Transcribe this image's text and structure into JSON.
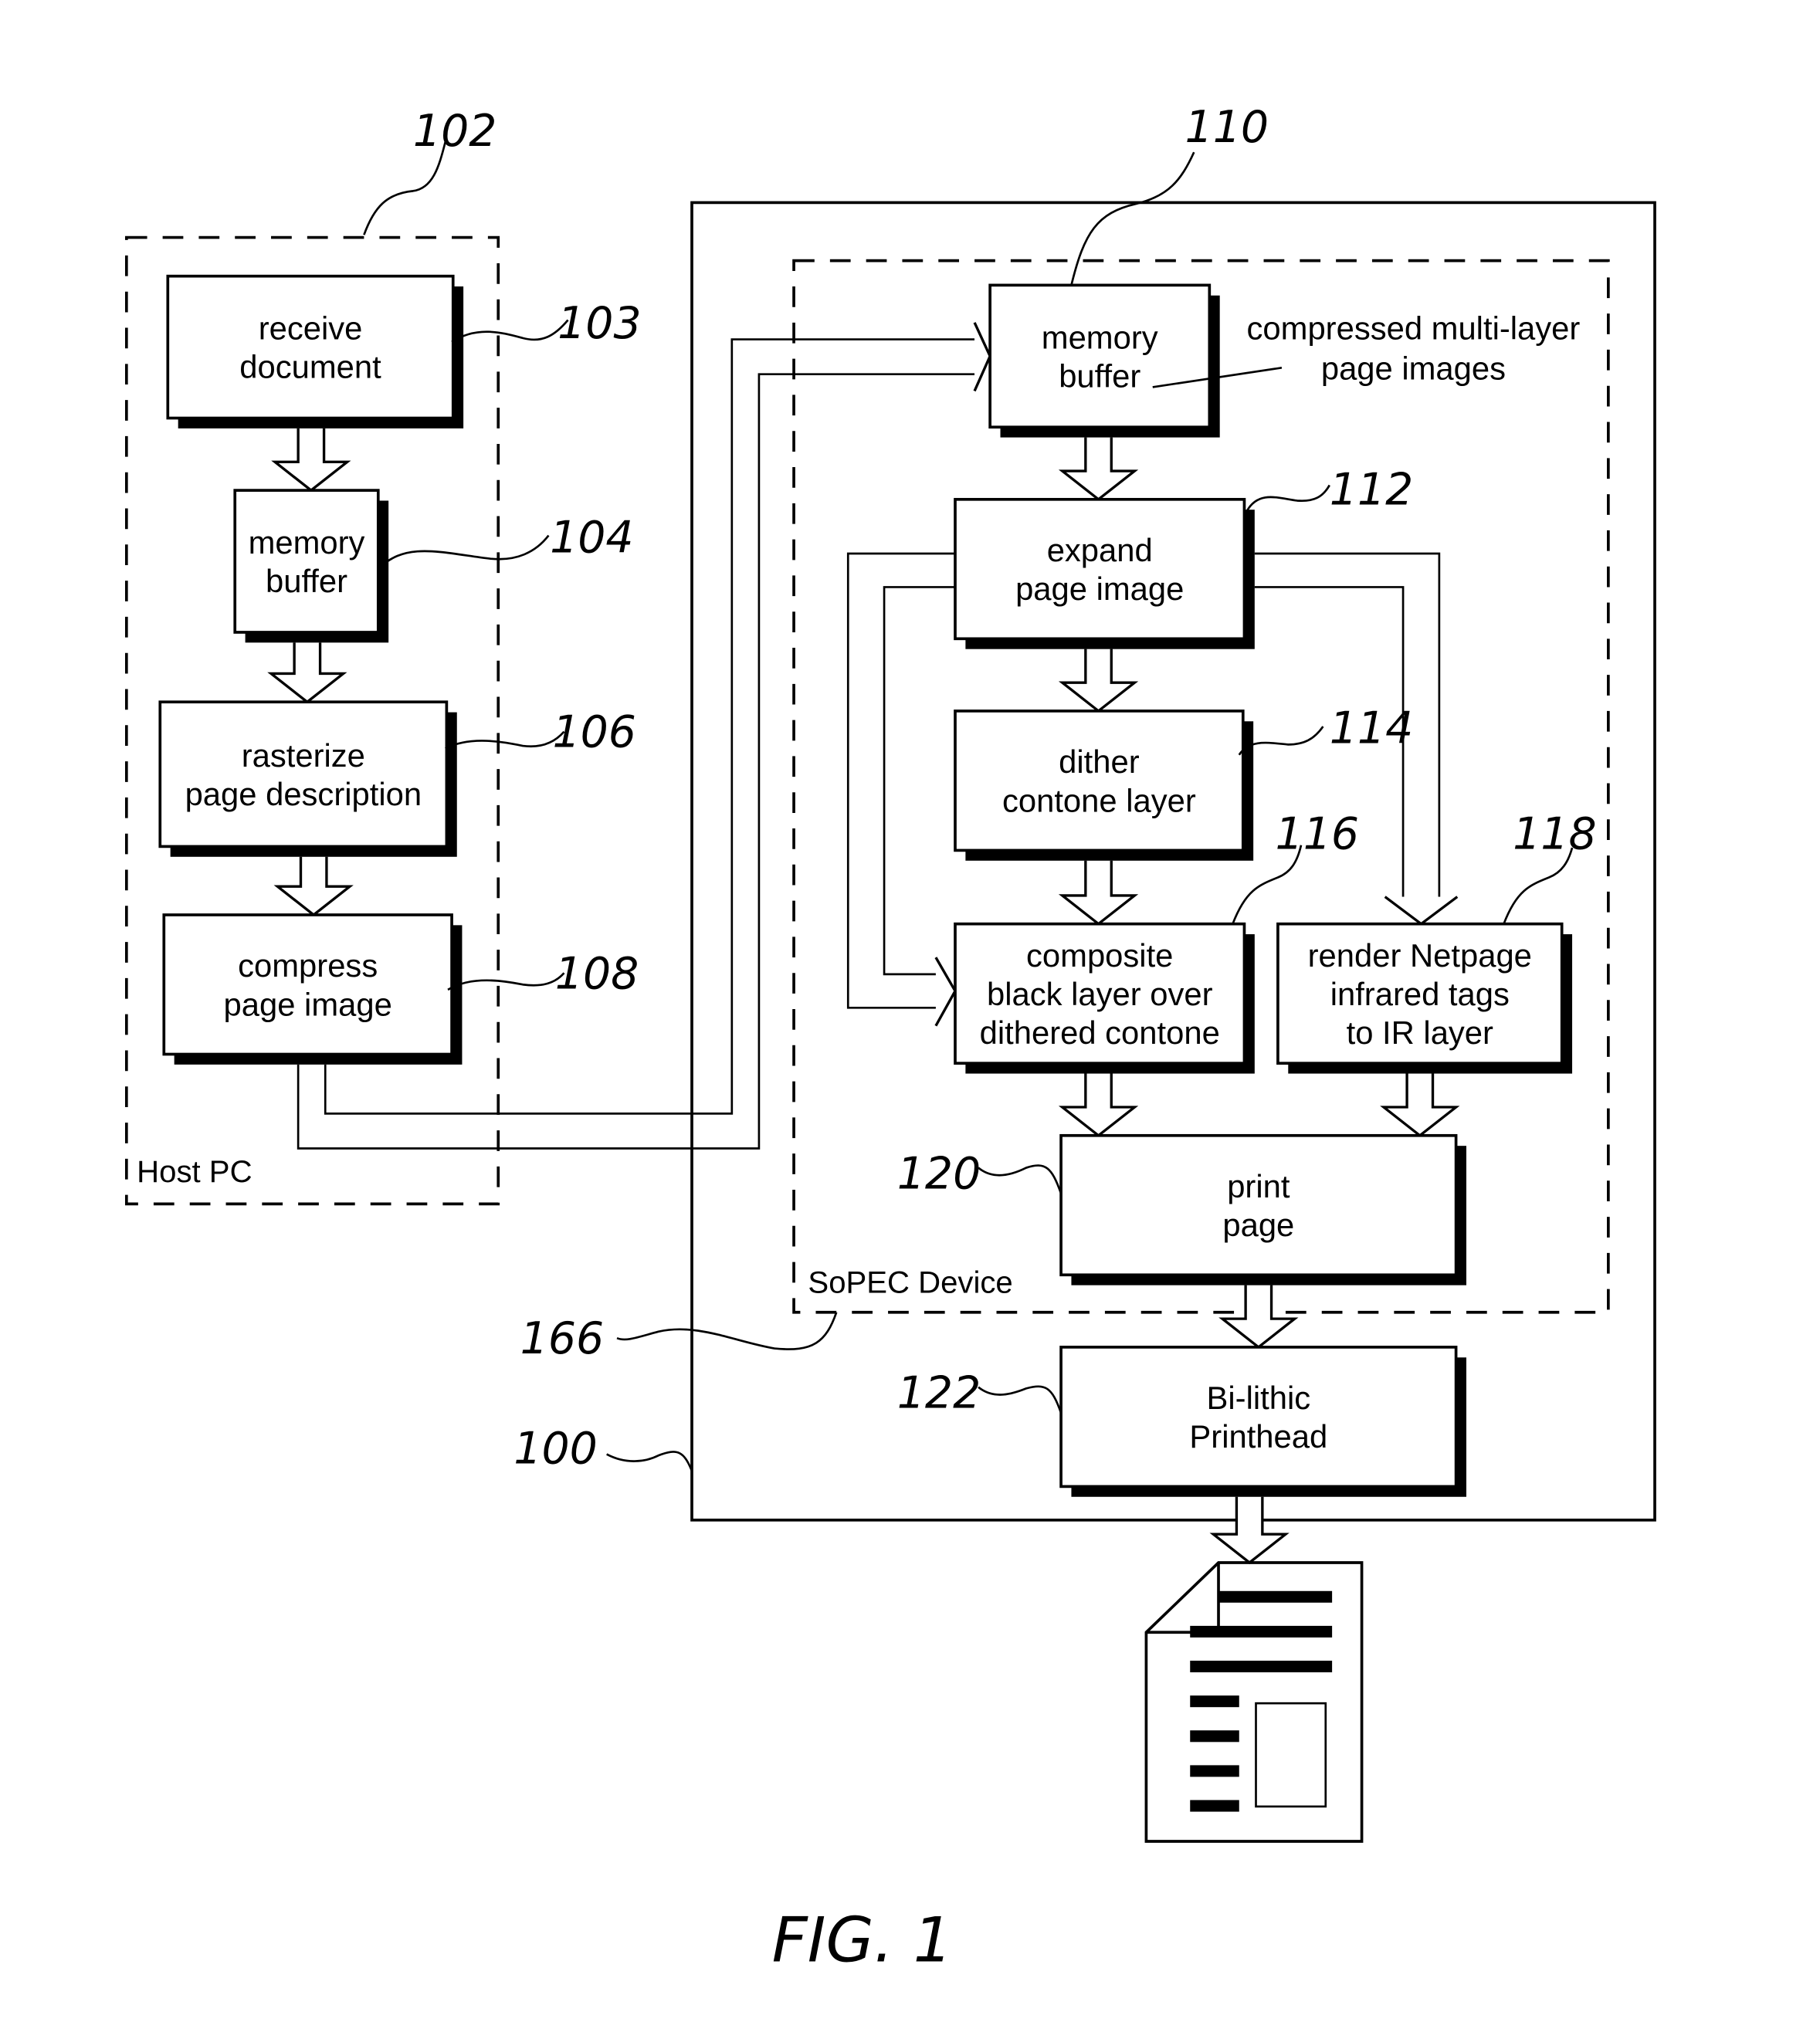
{
  "figure": {
    "caption": "FIG. 1",
    "colors": {
      "ink": "#000000",
      "paper": "#ffffff"
    }
  },
  "regions": {
    "host_pc": {
      "label": "Host PC",
      "ref": "102"
    },
    "printer": {
      "ref": "100"
    },
    "sopec": {
      "label": "SoPEC Device",
      "ref": "166"
    }
  },
  "boxes": {
    "receive_document": {
      "lines": [
        "receive",
        "document"
      ],
      "ref": "103"
    },
    "host_memory_buffer": {
      "lines": [
        "memory",
        "buffer"
      ],
      "ref": "104"
    },
    "rasterize": {
      "lines": [
        "rasterize",
        "page description"
      ],
      "ref": "106"
    },
    "compress": {
      "lines": [
        "compress",
        "page image"
      ],
      "ref": "108"
    },
    "sopec_memory_buffer": {
      "lines": [
        "memory",
        "buffer"
      ],
      "ref": "110"
    },
    "expand": {
      "lines": [
        "expand",
        "page image"
      ],
      "ref": "112"
    },
    "dither": {
      "lines": [
        "dither",
        "contone layer"
      ],
      "ref": "114"
    },
    "composite": {
      "lines": [
        "composite",
        "black layer over",
        "dithered contone"
      ],
      "ref": "116"
    },
    "render_netpage": {
      "lines": [
        "render Netpage",
        "infrared tags",
        "to IR layer"
      ],
      "ref": "118"
    },
    "print_page": {
      "lines": [
        "print",
        "page"
      ],
      "ref": "120"
    },
    "printhead": {
      "lines": [
        "Bi-lithic",
        "Printhead"
      ],
      "ref": "122"
    }
  },
  "annotations": {
    "memory_buffer_note": {
      "lines": [
        "compressed multi-layer",
        "page images"
      ]
    }
  },
  "output_icon": "printed-page-icon"
}
